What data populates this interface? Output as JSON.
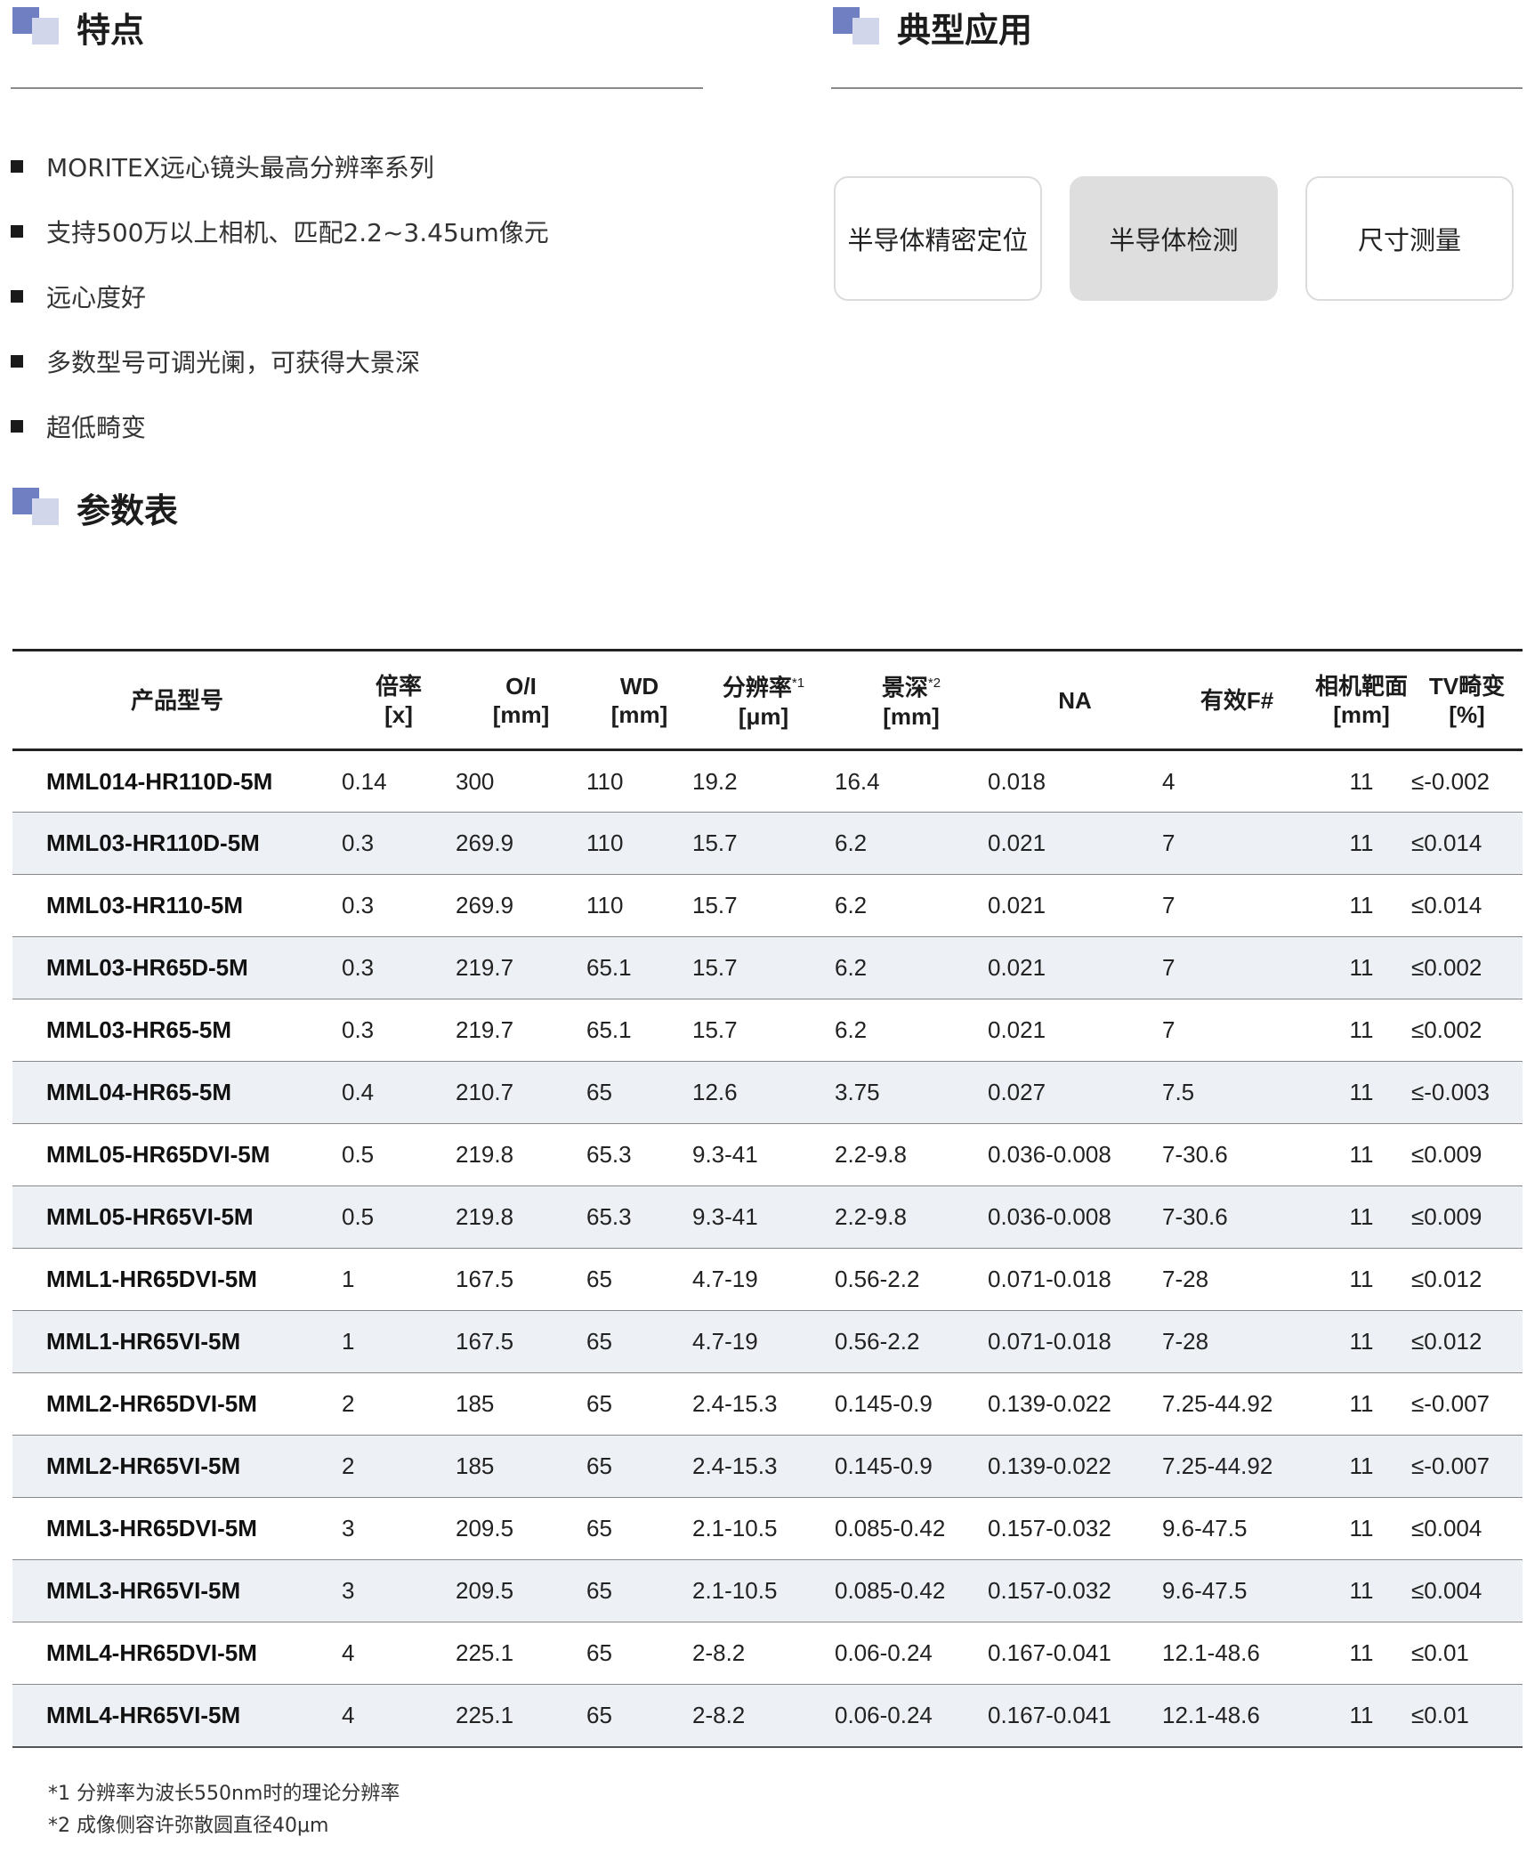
{
  "features_section": {
    "title": "特点",
    "items": [
      "MORITEX远心镜头最高分辨率系列",
      "支持500万以上相机、匹配2.2~3.45um像元",
      "远心度好",
      "多数型号可调光阑，可获得大景深",
      "超低畸变"
    ]
  },
  "applications_section": {
    "title": "典型应用",
    "cards": [
      {
        "label": "半导体精密定位",
        "active": false
      },
      {
        "label": "半导体检测",
        "active": true
      },
      {
        "label": "尺寸测量",
        "active": false
      }
    ]
  },
  "params_section": {
    "title": "参数表"
  },
  "table": {
    "headers": [
      {
        "line1": "产品型号",
        "line2": "",
        "sup": ""
      },
      {
        "line1": "倍率",
        "line2": "[x]",
        "sup": ""
      },
      {
        "line1": "O/I",
        "line2": "[mm]",
        "sup": ""
      },
      {
        "line1": "WD",
        "line2": "[mm]",
        "sup": ""
      },
      {
        "line1": "分辨率",
        "line2": "[μm]",
        "sup": "*1"
      },
      {
        "line1": "景深",
        "line2": "[mm]",
        "sup": "*2"
      },
      {
        "line1": "NA",
        "line2": "",
        "sup": ""
      },
      {
        "line1": "有效F#",
        "line2": "",
        "sup": ""
      },
      {
        "line1": "相机靶面",
        "line2": "[mm]",
        "sup": ""
      },
      {
        "line1": "TV畸变",
        "line2": "[%]",
        "sup": ""
      }
    ],
    "rows": [
      [
        "MML014-HR110D-5M",
        "0.14",
        "300",
        "110",
        "19.2",
        "16.4",
        "0.018",
        "4",
        "11",
        "≤-0.002"
      ],
      [
        "MML03-HR110D-5M",
        "0.3",
        "269.9",
        "110",
        "15.7",
        "6.2",
        "0.021",
        "7",
        "11",
        "≤0.014"
      ],
      [
        "MML03-HR110-5M",
        "0.3",
        "269.9",
        "110",
        "15.7",
        "6.2",
        "0.021",
        "7",
        "11",
        "≤0.014"
      ],
      [
        "MML03-HR65D-5M",
        "0.3",
        "219.7",
        "65.1",
        "15.7",
        "6.2",
        "0.021",
        "7",
        "11",
        "≤0.002"
      ],
      [
        "MML03-HR65-5M",
        "0.3",
        "219.7",
        "65.1",
        "15.7",
        "6.2",
        "0.021",
        "7",
        "11",
        "≤0.002"
      ],
      [
        "MML04-HR65-5M",
        "0.4",
        "210.7",
        "65",
        "12.6",
        "3.75",
        "0.027",
        "7.5",
        "11",
        "≤-0.003"
      ],
      [
        "MML05-HR65DVI-5M",
        "0.5",
        "219.8",
        "65.3",
        "9.3-41",
        "2.2-9.8",
        "0.036-0.008",
        "7-30.6",
        "11",
        "≤0.009"
      ],
      [
        "MML05-HR65VI-5M",
        "0.5",
        "219.8",
        "65.3",
        "9.3-41",
        "2.2-9.8",
        "0.036-0.008",
        "7-30.6",
        "11",
        "≤0.009"
      ],
      [
        "MML1-HR65DVI-5M",
        "1",
        "167.5",
        "65",
        "4.7-19",
        "0.56-2.2",
        "0.071-0.018",
        "7-28",
        "11",
        "≤0.012"
      ],
      [
        "MML1-HR65VI-5M",
        "1",
        "167.5",
        "65",
        "4.7-19",
        "0.56-2.2",
        "0.071-0.018",
        "7-28",
        "11",
        "≤0.012"
      ],
      [
        "MML2-HR65DVI-5M",
        "2",
        "185",
        "65",
        "2.4-15.3",
        "0.145-0.9",
        "0.139-0.022",
        "7.25-44.92",
        "11",
        "≤-0.007"
      ],
      [
        "MML2-HR65VI-5M",
        "2",
        "185",
        "65",
        "2.4-15.3",
        "0.145-0.9",
        "0.139-0.022",
        "7.25-44.92",
        "11",
        "≤-0.007"
      ],
      [
        "MML3-HR65DVI-5M",
        "3",
        "209.5",
        "65",
        "2.1-10.5",
        "0.085-0.42",
        "0.157-0.032",
        "9.6-47.5",
        "11",
        "≤0.004"
      ],
      [
        "MML3-HR65VI-5M",
        "3",
        "209.5",
        "65",
        "2.1-10.5",
        "0.085-0.42",
        "0.157-0.032",
        "9.6-47.5",
        "11",
        "≤0.004"
      ],
      [
        "MML4-HR65DVI-5M",
        "4",
        "225.1",
        "65",
        "2-8.2",
        "0.06-0.24",
        "0.167-0.041",
        "12.1-48.6",
        "11",
        "≤0.01"
      ],
      [
        "MML4-HR65VI-5M",
        "4",
        "225.1",
        "65",
        "2-8.2",
        "0.06-0.24",
        "0.167-0.041",
        "12.1-48.6",
        "11",
        "≤0.01"
      ]
    ]
  },
  "footnotes": [
    "*1 分辨率为波长550nm时的理论分辨率",
    "*2 成像侧容许弥散圆直径40μm"
  ]
}
